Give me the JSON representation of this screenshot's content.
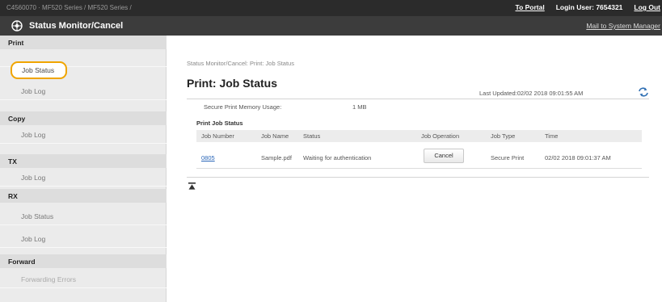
{
  "topbar": {
    "device_name": "C4560070 · MF520 Series / MF520 Series /",
    "portal_link": "To Portal",
    "login_user": "Login User:  7654321",
    "logout": "Log Out"
  },
  "header": {
    "app_title": "Status Monitor/Cancel",
    "mail_link": "Mail to System Manager"
  },
  "sidebar": {
    "print": {
      "heading": "Print",
      "job_status": "Job Status",
      "job_log": "Job Log"
    },
    "copy": {
      "heading": "Copy",
      "job_log": "Job Log"
    },
    "tx": {
      "heading": "TX",
      "job_log": "Job Log"
    },
    "rx": {
      "heading": "RX",
      "job_status": "Job Status",
      "job_log": "Job Log"
    },
    "forward": {
      "heading": "Forward",
      "forwarding_errors": "Forwarding Errors"
    }
  },
  "main": {
    "breadcrumb": "Status Monitor/Cancel: Print: Job Status",
    "title": "Print: Job Status",
    "last_updated": "Last Updated:02/02 2018 09:01:55 AM",
    "memory_label": "Secure Print Memory Usage:",
    "memory_value": "1 MB",
    "section_title": "Print Job Status",
    "columns": {
      "job_number": "Job Number",
      "job_name": "Job Name",
      "status": "Status",
      "job_operation": "Job Operation",
      "job_type": "Job Type",
      "time": "Time"
    },
    "row": {
      "job_number": "0805",
      "job_name": "Sample.pdf",
      "status": "Waiting for authentication",
      "operation": "Cancel",
      "job_type": "Secure Print",
      "time": "02/02 2018 09:01:37 AM"
    }
  },
  "colors": {
    "header_bg": "#3c3c3c",
    "topbar_bg": "#2b2b2b",
    "selected_outline": "#f0a500",
    "link": "#2a66b8"
  },
  "icons": {
    "logo": "device-logo-icon",
    "refresh": "refresh-icon",
    "back_to_top": "back-to-top-icon"
  }
}
